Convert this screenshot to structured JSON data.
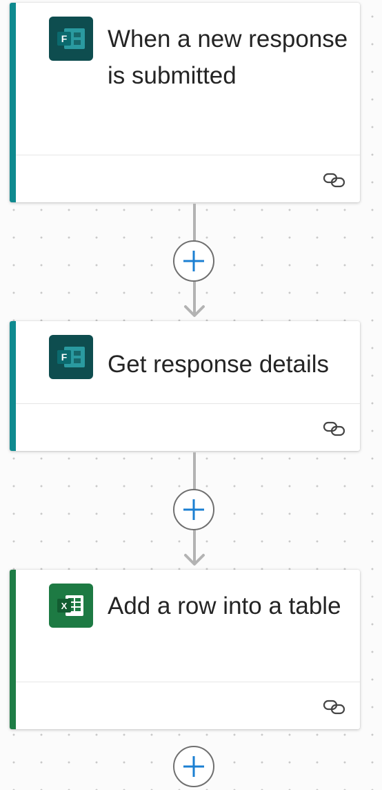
{
  "colors": {
    "forms_accent": "#0f8a8f",
    "excel_accent": "#1e7d46",
    "forms_icon_bg": "#0e4d4f",
    "excel_icon_bg": "#1d7a43",
    "plus_blue": "#1b7fd2",
    "connector_gray": "#b3b3b3"
  },
  "flow": {
    "steps": [
      {
        "title": "When a new response is submitted",
        "icon": "microsoft-forms-icon",
        "footer_icon": "connection-link-icon"
      },
      {
        "title": "Get response details",
        "icon": "microsoft-forms-icon",
        "footer_icon": "connection-link-icon"
      },
      {
        "title": "Add a row into a table",
        "icon": "microsoft-excel-icon",
        "footer_icon": "connection-link-icon"
      }
    ],
    "add_step_icon": "plus-icon"
  }
}
